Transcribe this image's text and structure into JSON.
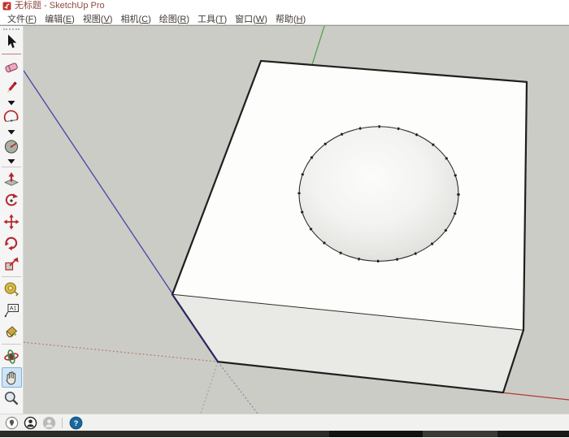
{
  "window": {
    "title": "无标题 - SketchUp Pro",
    "logo_color": "#c5342c"
  },
  "menu": {
    "items": [
      {
        "label": "文件",
        "key": "F"
      },
      {
        "label": "编辑",
        "key": "E"
      },
      {
        "label": "视图",
        "key": "V"
      },
      {
        "label": "相机",
        "key": "C"
      },
      {
        "label": "绘图",
        "key": "R"
      },
      {
        "label": "工具",
        "key": "T"
      },
      {
        "label": "窗口",
        "key": "W"
      },
      {
        "label": "帮助",
        "key": "H"
      }
    ]
  },
  "toolbar": {
    "active_tool": "pan",
    "text_tool_label": "A1",
    "tools": [
      {
        "icon": "select-icon"
      },
      {
        "icon": "eraser-icon"
      },
      {
        "icon": "line-icon"
      },
      {
        "icon": "arc-icon"
      },
      {
        "icon": "circle-icon"
      },
      {
        "icon": "push-pull-icon"
      },
      {
        "icon": "follow-me-icon"
      },
      {
        "icon": "move-icon"
      },
      {
        "icon": "rotate-icon"
      },
      {
        "icon": "scale-icon"
      },
      {
        "icon": "tape-measure-icon"
      },
      {
        "icon": "text-icon"
      },
      {
        "icon": "paint-bucket-icon"
      },
      {
        "icon": "orbit-icon"
      },
      {
        "icon": "pan-icon"
      },
      {
        "icon": "zoom-icon"
      }
    ]
  },
  "viewport": {
    "colors": {
      "bg": "#cbccc5",
      "axis_red": "#b13b35",
      "axis_green": "#4f9e4f",
      "axis_blue": "#4d4da8",
      "dotted_red": "#bb7a74",
      "dotted_green": "#a2a79d",
      "dotted_blue": "#8585b5",
      "face_top": "#fdfdfb",
      "face_front": "#e9e9e5",
      "edge": "#1f1f1f",
      "edge_blue": "#26265e"
    }
  },
  "statusbar": {
    "help_label": "?",
    "icons": [
      {
        "icon": "geolocation-icon"
      },
      {
        "icon": "credit-person-icon"
      },
      {
        "icon": "signin-person-icon"
      },
      {
        "icon": "help-icon"
      }
    ]
  }
}
